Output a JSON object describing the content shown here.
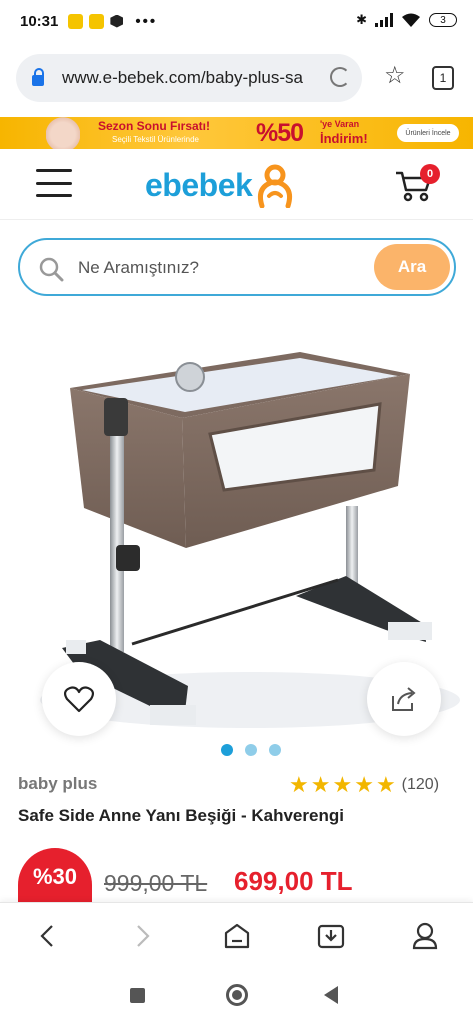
{
  "status_bar": {
    "time": "10:31",
    "battery": "3"
  },
  "browser": {
    "url": "www.e-bebek.com/baby-plus-sa",
    "tab_count": "1"
  },
  "banner": {
    "title": "Sezon Sonu Fırsatı!",
    "subtitle": "Seçili Tekstil Ürünlerinde",
    "percent": "%50",
    "right_line1": "'ye Varan",
    "right_line2": "İndirim!",
    "cta": "Ürünleri İncele"
  },
  "header": {
    "logo": "ebebek",
    "cart_count": "0"
  },
  "search": {
    "placeholder": "Ne Aramıştınız?",
    "button": "Ara"
  },
  "carousel": {
    "slides": 3,
    "active_index": 0
  },
  "product": {
    "brand": "baby plus",
    "rating": 5,
    "review_count": "(120)",
    "title": "Safe Side Anne Yanı Beşiği - Kahverengi",
    "discount": "%30",
    "old_price": "999,00 TL",
    "new_price": "699,00 TL"
  },
  "colors": {
    "brand_blue": "#1d9fd9",
    "brand_orange": "#f7941d",
    "search_button": "#fbb46a",
    "price_red": "#e6202d",
    "star_yellow": "#f2b600"
  },
  "icons": {
    "lock": "lock-icon",
    "reload": "reload-icon",
    "bookmark": "star-icon",
    "tabs": "tabs-icon",
    "menu": "hamburger-icon",
    "cart": "cart-icon",
    "search": "search-icon",
    "favorite": "heart-icon",
    "share": "share-icon",
    "back": "chevron-left-icon",
    "forward": "chevron-right-icon",
    "home": "home-icon",
    "download": "download-icon",
    "profile": "profile-icon"
  }
}
